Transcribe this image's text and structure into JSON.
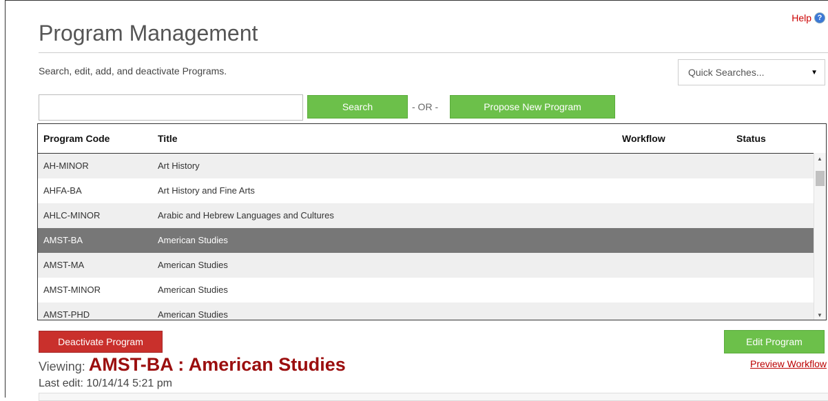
{
  "header": {
    "help_label": "Help",
    "help_icon": "question-icon",
    "title": "Program Management",
    "subtitle": "Search, edit, add, and deactivate Programs.",
    "quick_searches": "Quick Searches..."
  },
  "search": {
    "value": "",
    "button_label": "Search",
    "or_label": "- OR -",
    "propose_label": "Propose New Program"
  },
  "table": {
    "columns": [
      "Program Code",
      "Title",
      "Workflow",
      "Status"
    ],
    "rows": [
      {
        "code": "AH-MINOR",
        "title": "Art History",
        "workflow": "",
        "status": ""
      },
      {
        "code": "AHFA-BA",
        "title": "Art History and Fine Arts",
        "workflow": "",
        "status": ""
      },
      {
        "code": "AHLC-MINOR",
        "title": "Arabic and Hebrew Languages and Cultures",
        "workflow": "",
        "status": ""
      },
      {
        "code": "AMST-BA",
        "title": "American Studies",
        "workflow": "",
        "status": "",
        "selected": true
      },
      {
        "code": "AMST-MA",
        "title": "American Studies",
        "workflow": "",
        "status": ""
      },
      {
        "code": "AMST-MINOR",
        "title": "American Studies",
        "workflow": "",
        "status": ""
      },
      {
        "code": "AMST-PHD",
        "title": "American Studies",
        "workflow": "",
        "status": ""
      }
    ]
  },
  "actions": {
    "deactivate_label": "Deactivate Program",
    "edit_label": "Edit Program",
    "preview_label": "Preview Workflow"
  },
  "viewing": {
    "label": "Viewing:",
    "value": "AMST-BA : American Studies",
    "last_edit": "Last edit: 10/14/14 5:21 pm"
  },
  "colors": {
    "green": "#6cc04a",
    "red": "#c9302c",
    "accent_dark_red": "#9b0e0e",
    "selected_row": "#777777"
  }
}
